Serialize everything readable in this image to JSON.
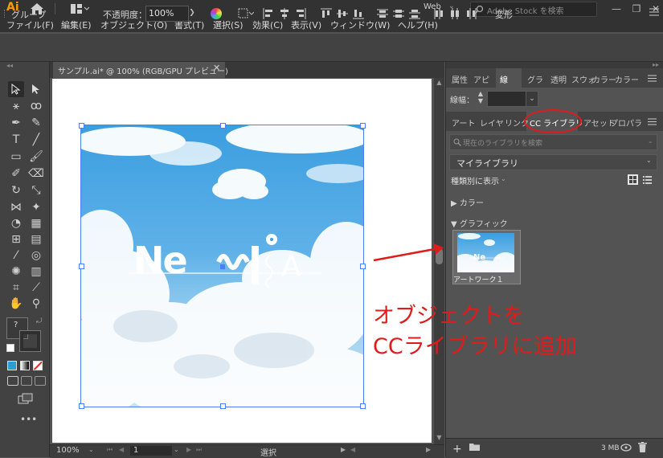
{
  "app": {
    "logo": "Ai",
    "workspace": "Web",
    "stock_search_placeholder": "Adobe Stock を検索",
    "win_minimize": "—",
    "win_maximize": "❐",
    "win_close": "✕"
  },
  "menu": [
    "ファイル(F)",
    "編集(E)",
    "オブジェクト(O)",
    "書式(T)",
    "選択(S)",
    "効果(C)",
    "表示(V)",
    "ウィンドウ(W)",
    "ヘルプ(H)"
  ],
  "control_bar": {
    "selection_type": "グループ",
    "opacity_label": "不透明度：",
    "opacity_value": "100%",
    "transform_label": "変形"
  },
  "document": {
    "tab_title": "サンプル.ai* @ 100% (RGB/GPU プレビュー)",
    "close": "✕"
  },
  "artwork": {
    "logo_text_left": "Ne",
    "logo_text_right": "A"
  },
  "status_bar": {
    "zoom": "100%",
    "page": "1",
    "tool": "選択"
  },
  "panel_top_tabs": [
    "属性",
    "アピ",
    "線",
    "グラ",
    "透明",
    "スウォ",
    "カラー",
    "カラー"
  ],
  "stroke": {
    "label": "線幅：",
    "value": ""
  },
  "panel_second_tabs": [
    "アート",
    "レイヤ",
    "リンク",
    "CC ライブラリ",
    "アセット",
    "プロパラ"
  ],
  "library": {
    "search_placeholder": "現在のライブラリを検索",
    "selected_library": "マイライブラリ",
    "view_by": "種類別に表示",
    "section_colors": "▶ カラー",
    "section_graphics": "▼ グラフィック",
    "item_label": "アートワーク１",
    "storage": "3 MB"
  },
  "annotation": {
    "line1": "オブジェクトを",
    "line2": "CCライブラリに追加"
  },
  "colors": {
    "accent": "#ff9a00",
    "selection": "#4e7cff",
    "annotation": "#e01b1b"
  }
}
